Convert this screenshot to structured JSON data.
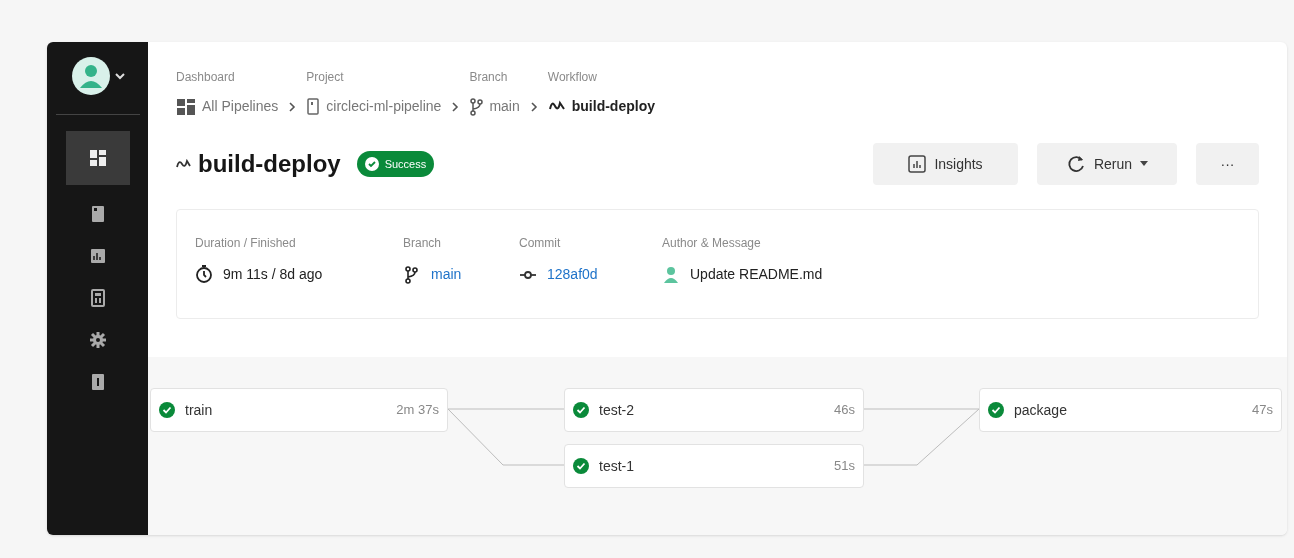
{
  "sidebar": {
    "items": [
      {
        "kind": "dashboard",
        "selected": true
      },
      {
        "kind": "projects",
        "selected": false
      },
      {
        "kind": "insights",
        "selected": false
      },
      {
        "kind": "plans",
        "selected": false
      },
      {
        "kind": "settings",
        "selected": false
      },
      {
        "kind": "organization",
        "selected": false
      }
    ]
  },
  "breadcrumbs": [
    {
      "label": "Dashboard",
      "value": "All Pipelines",
      "kind": "dashboard",
      "current": false
    },
    {
      "label": "Project",
      "value": "circleci-ml-pipeline",
      "kind": "project",
      "current": false
    },
    {
      "label": "Branch",
      "value": "main",
      "kind": "branch",
      "current": false
    },
    {
      "label": "Workflow",
      "value": "build-deploy",
      "kind": "workflow",
      "current": true
    }
  ],
  "title": "build-deploy",
  "status": {
    "label": "Success",
    "kind": "success"
  },
  "actions": [
    {
      "kind": "insights",
      "label": "Insights"
    },
    {
      "kind": "rerun",
      "label": "Rerun"
    },
    {
      "kind": "more",
      "label": "···"
    }
  ],
  "details": [
    {
      "label": "Duration / Finished",
      "value": "9m 11s / 8d ago",
      "kind": "timer",
      "link": false
    },
    {
      "label": "Branch",
      "value": "main",
      "kind": "branch",
      "link": true
    },
    {
      "label": "Commit",
      "value": "128af0d",
      "kind": "commit",
      "link": true
    },
    {
      "label": "Author & Message",
      "value": "Update README.md",
      "kind": "author",
      "link": false
    }
  ],
  "stages": [
    {
      "jobs": [
        {
          "name": "train",
          "duration": "2m 37s",
          "kind": "success"
        }
      ]
    },
    {
      "jobs": [
        {
          "name": "test-2",
          "duration": "46s",
          "kind": "success"
        },
        {
          "name": "test-1",
          "duration": "51s",
          "kind": "success"
        }
      ]
    },
    {
      "jobs": [
        {
          "name": "package",
          "duration": "47s",
          "kind": "success"
        }
      ]
    }
  ]
}
